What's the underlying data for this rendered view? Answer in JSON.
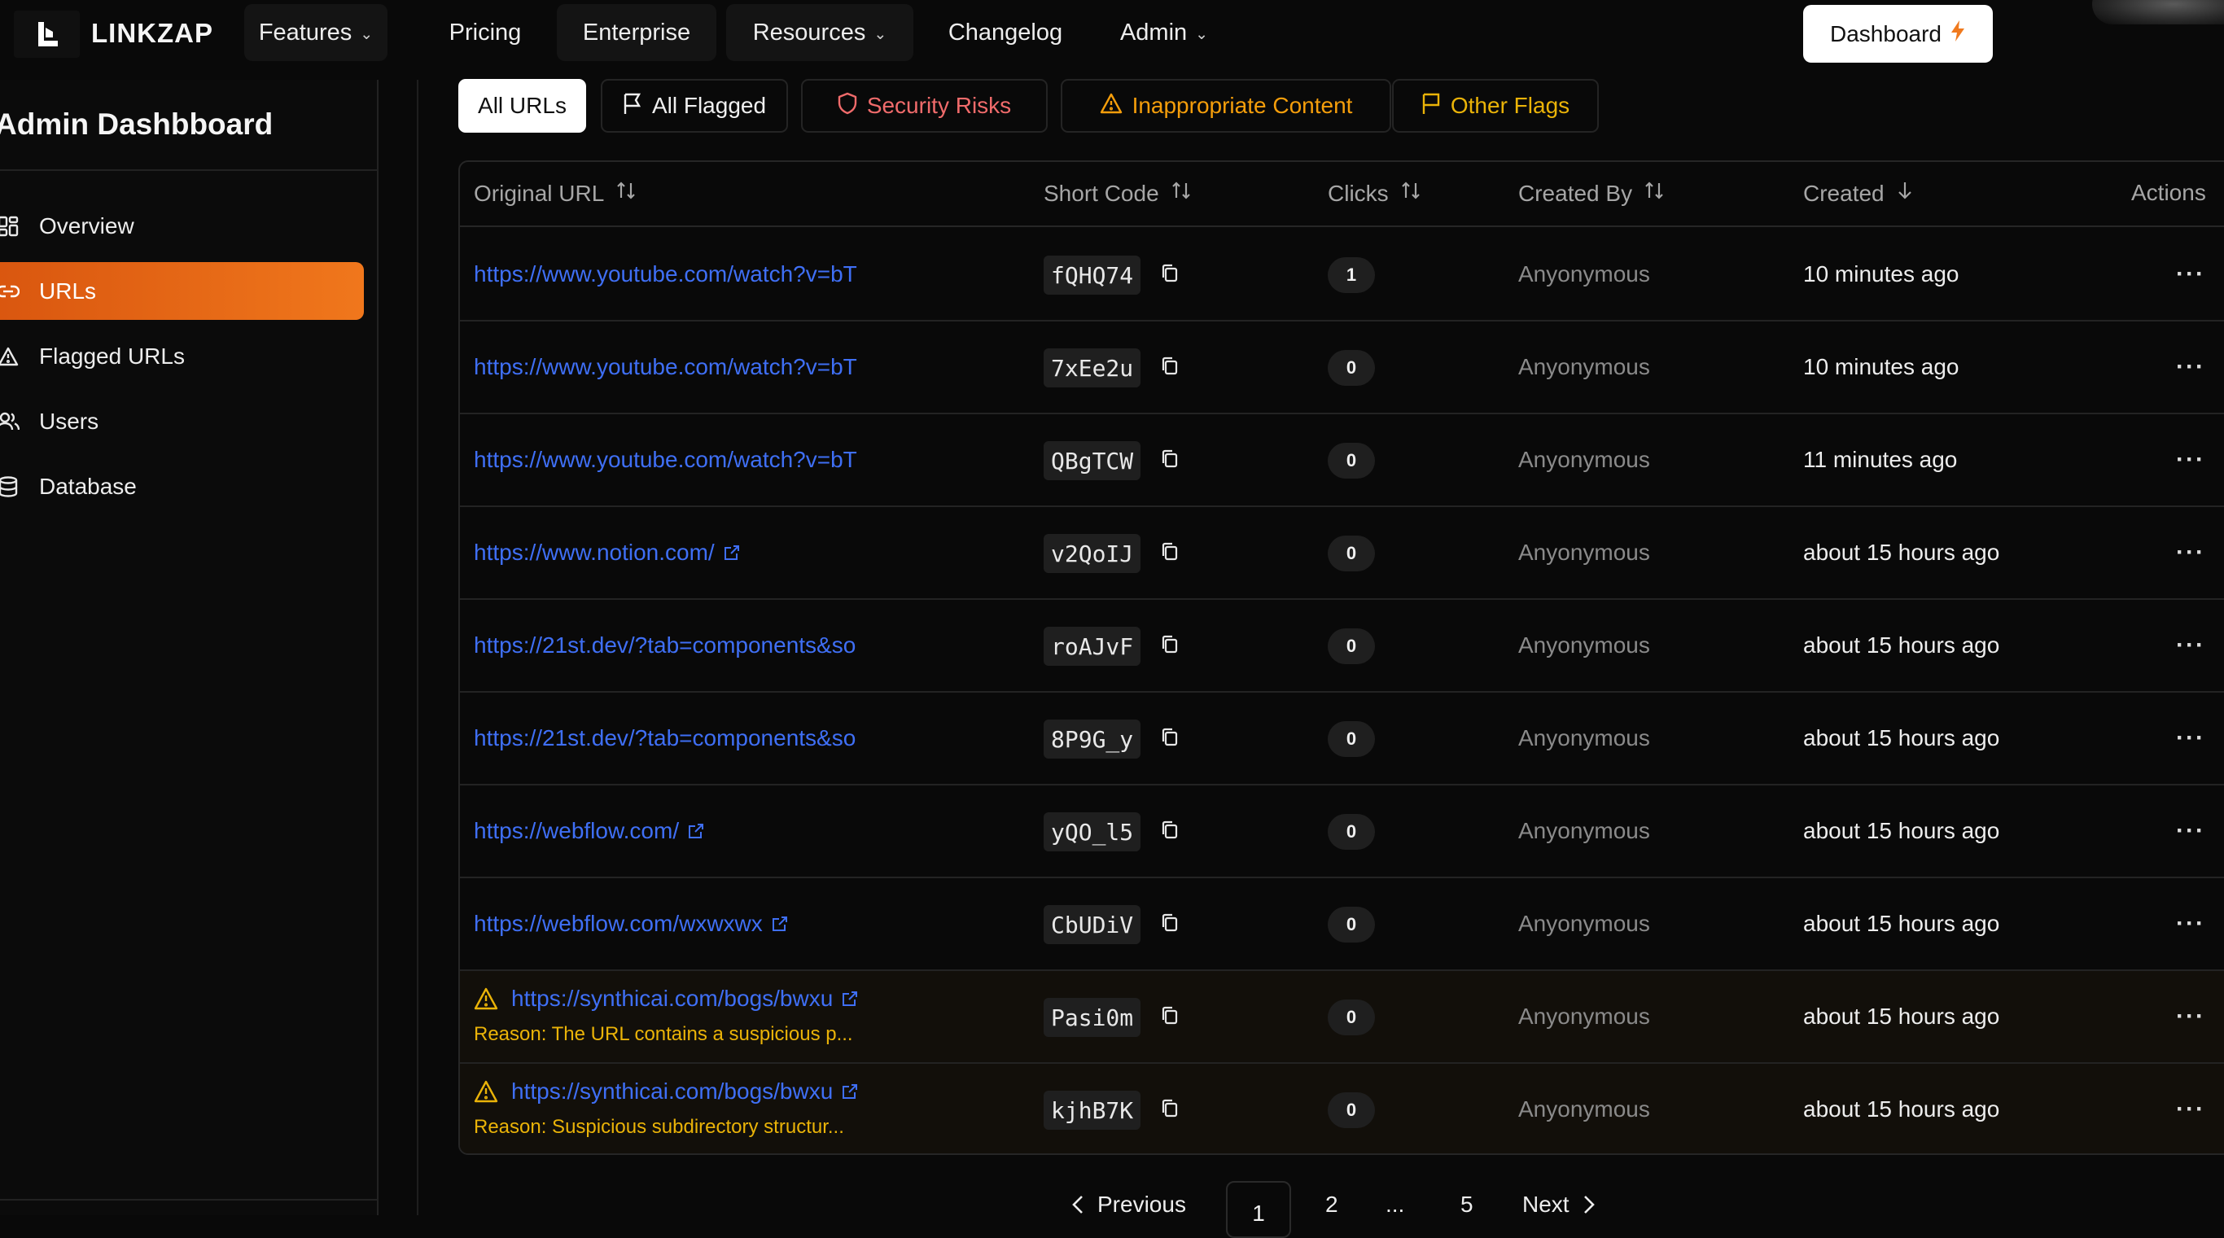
{
  "brand": {
    "name": "LINKZAP"
  },
  "nav": {
    "features": "Features",
    "pricing": "Pricing",
    "enterprise": "Enterprise",
    "resources": "Resources",
    "changelog": "Changelog",
    "admin": "Admin",
    "dashboard": "Dashboard"
  },
  "sidebar": {
    "title": "Admin Dashbboard",
    "items": [
      {
        "label": "Overview",
        "icon": "grid-icon",
        "active": false
      },
      {
        "label": "URLs",
        "icon": "link-icon",
        "active": true
      },
      {
        "label": "Flagged URLs",
        "icon": "warning-triangle-icon",
        "active": false
      },
      {
        "label": "Users",
        "icon": "users-icon",
        "active": false
      },
      {
        "label": "Database",
        "icon": "database-icon",
        "active": false
      }
    ]
  },
  "filters": {
    "all_urls": "All URLs",
    "all_flagged": "All Flagged",
    "security_risks": "Security Risks",
    "inappropriate": "Inappropriate Content",
    "other_flags": "Other Flags"
  },
  "table": {
    "headers": {
      "original_url": "Original URL",
      "short_code": "Short Code",
      "clicks": "Clicks",
      "created_by": "Created By",
      "created": "Created",
      "actions": "Actions"
    },
    "rows": [
      {
        "url": "https://www.youtube.com/watch?v=bT",
        "code": "fQHQ74",
        "clicks": "1",
        "creator": "Anyonymous",
        "created": "10 minutes ago"
      },
      {
        "url": "https://www.youtube.com/watch?v=bT",
        "code": "7xEe2u",
        "clicks": "0",
        "creator": "Anyonymous",
        "created": "10 minutes ago"
      },
      {
        "url": "https://www.youtube.com/watch?v=bT",
        "code": "QBgTCW",
        "clicks": "0",
        "creator": "Anyonymous",
        "created": "11 minutes ago"
      },
      {
        "url": "https://www.notion.com/",
        "code": "v2QoIJ",
        "clicks": "0",
        "creator": "Anyonymous",
        "created": "about 15 hours ago"
      },
      {
        "url": "https://21st.dev/?tab=components&so",
        "code": "roAJvF",
        "clicks": "0",
        "creator": "Anyonymous",
        "created": "about 15 hours ago"
      },
      {
        "url": "https://21st.dev/?tab=components&so",
        "code": "8P9G_y",
        "clicks": "0",
        "creator": "Anyonymous",
        "created": "about 15 hours ago"
      },
      {
        "url": "https://webflow.com/",
        "code": "yQO_l5",
        "clicks": "0",
        "creator": "Anyonymous",
        "created": "about 15 hours ago"
      },
      {
        "url": "https://webflow.com/wxwxwx",
        "code": "CbUDiV",
        "clicks": "0",
        "creator": "Anyonymous",
        "created": "about 15 hours ago"
      },
      {
        "url": "https://synthicai.com/bogs/bwxu",
        "reason": "Reason: The URL contains a suspicious p...",
        "code": "Pasi0m",
        "clicks": "0",
        "creator": "Anyonymous",
        "created": "about 15 hours ago"
      },
      {
        "url": "https://synthicai.com/bogs/bwxu",
        "reason": "Reason: Suspicious subdirectory structur...",
        "code": "kjhB7K",
        "clicks": "0",
        "creator": "Anyonymous",
        "created": "about 15 hours ago"
      }
    ]
  },
  "pagination": {
    "previous": "Previous",
    "pages": [
      "1",
      "2",
      "...",
      "5"
    ],
    "next": "Next"
  },
  "colors": {
    "accent": "#f0771c",
    "link": "#3f6ff5",
    "security": "#f06b6b",
    "warning": "#f59e0b",
    "flag": "#eab308"
  }
}
